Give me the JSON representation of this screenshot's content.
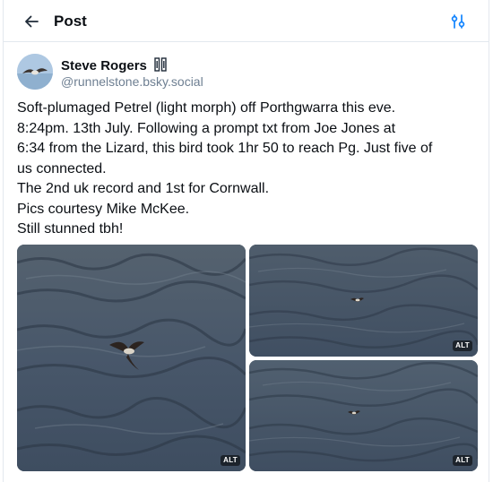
{
  "header": {
    "title": "Post",
    "back_icon": "arrow-left-icon",
    "filter_icon": "sliders-icon"
  },
  "author": {
    "display_name": "Steve Rogers",
    "badge_icon": "pause-bars-icon",
    "handle": "@runnelstone.bsky.social"
  },
  "post": {
    "lines": [
      "Soft-plumaged Petrel (light morph) off Porthgwarra this eve.",
      "8:24pm. 13th July.  Following a prompt txt from Joe Jones at",
      "6:34 from the Lizard, this bird took 1hr 50 to reach Pg. Just five of",
      "us connected.",
      "The 2nd uk record and 1st for Cornwall.",
      "Pics courtesy Mike McKee.",
      "Still stunned tbh!"
    ]
  },
  "images": [
    {
      "alt_label": "ALT"
    },
    {
      "alt_label": "ALT"
    },
    {
      "alt_label": "ALT"
    }
  ],
  "colors": {
    "text": "#0b0f14",
    "muted": "#6e7f92",
    "accent": "#1083fe",
    "border": "#e3e8ee"
  }
}
